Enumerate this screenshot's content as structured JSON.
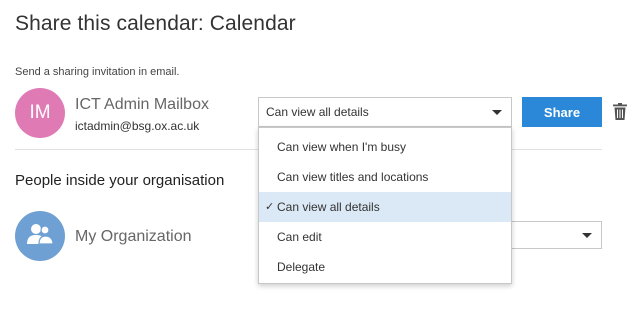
{
  "dialog": {
    "title": "Share this calendar: Calendar",
    "subtitle": "Send a sharing invitation in email."
  },
  "recipient": {
    "initials": "IM",
    "name": "ICT Admin Mailbox",
    "email": "ictadmin@bsg.ox.ac.uk",
    "avatar_color": "#e07ab5",
    "permission": "Can view all details"
  },
  "share_button": {
    "label": "Share",
    "color": "#2b88d8"
  },
  "delete_icon": "trash-icon",
  "permission_options": [
    {
      "label": "Can view when I'm busy",
      "selected": false
    },
    {
      "label": "Can view titles and locations",
      "selected": false
    },
    {
      "label": "Can view all details",
      "selected": true
    },
    {
      "label": "Can edit",
      "selected": false
    },
    {
      "label": "Delegate",
      "selected": false
    }
  ],
  "organisation": {
    "section_title": "People inside your organisation",
    "name": "My Organization",
    "avatar_icon": "people-icon",
    "avatar_color": "#6fa0d3"
  }
}
